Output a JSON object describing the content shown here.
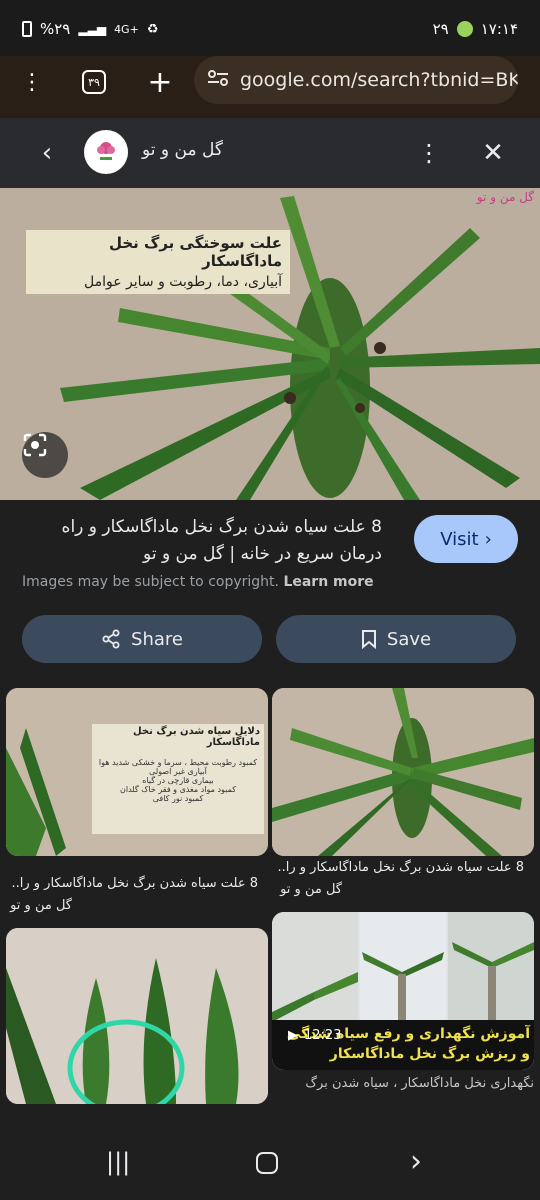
{
  "status": {
    "time": "۱۷:۱۴",
    "date_num": "۲۹",
    "battery": "%۲۹",
    "network": "4G+"
  },
  "browser": {
    "url": "google.com/search?tbnid=BKpO",
    "tab_count": "۳۹"
  },
  "result": {
    "site_name": "گل من و تو",
    "hero_caption_line1": "علت سوختگی برگ نخل ماداگاسکار",
    "hero_caption_line2": "آبیاری، دما، رطوبت و سایر عوامل",
    "hero_logo": "گل من و تو",
    "title": "8 علت سیاه شدن برگ نخل ماداگاسکار و راه درمان سریع در خانه | گل من و تو",
    "visit_label": "Visit",
    "copyright_text": "Images may be subject to copyright.",
    "learn_more": "Learn more",
    "share_label": "Share",
    "save_label": "Save"
  },
  "related": [
    {
      "title": "8 علت سیاه شدن برگ نخل ماداگاسکار و را..",
      "source": "گل من و تو",
      "overlay_title": "دلایل سیاه شدن برگ نخل ماداگاسکار",
      "overlay_lines": [
        "کمبود رطوبت محیط ، سرما و خشکی شدید هوا",
        "آبیاری غیر اصولی",
        "بیماری قارچی در گیاه",
        "کمبود مواد مغذی و فقر خاک گلدان",
        "کمبود نور کافی"
      ]
    },
    {
      "title": "8 علت سیاه شدن برگ نخل ماداگاسکار و را..",
      "source": "گل من و تو"
    },
    {
      "title": "",
      "source": ""
    },
    {
      "overlay": "آموزش نگهداری و رفع سیاه شدگی و ریزش برگ نخل ماداگاسکار",
      "duration": "12:23",
      "title": "نگهداری نخل ماداگاسکار ، سیاه شدن برگ"
    }
  ],
  "colors": {
    "visit_bg": "#a8c7fa",
    "action_bg": "#3c4a5e",
    "header_bg": "#2a2b2e"
  }
}
